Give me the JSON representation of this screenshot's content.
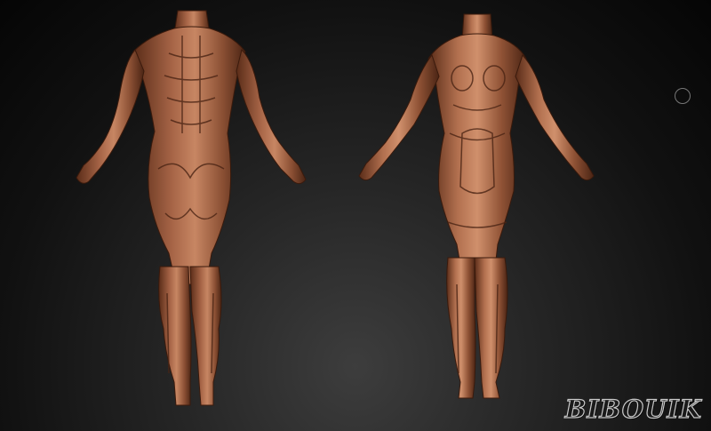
{
  "scene": {
    "background": "#262626",
    "figure_color": "#9a5a3c",
    "figure_highlight": "#c78663",
    "figure_shadow": "#4a2414",
    "views": [
      {
        "name": "back-view",
        "icon": "figure-back-icon"
      },
      {
        "name": "front-view",
        "icon": "figure-front-icon"
      }
    ],
    "cursor_icon": "circle-cursor-icon"
  },
  "watermark": {
    "text": "BIBOUIK"
  }
}
